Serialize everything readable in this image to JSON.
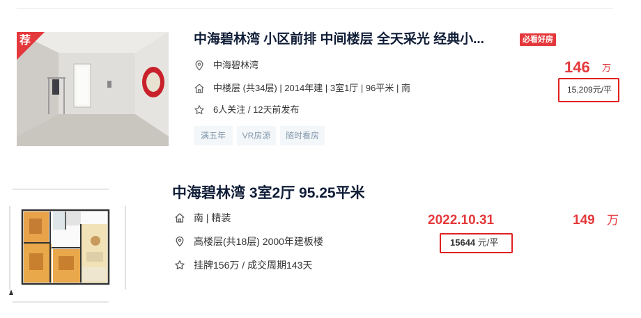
{
  "listing1": {
    "recommend_badge": "荐",
    "title": "中海碧林湾 小区前排 中间楼层 全天采光 经典小...",
    "must_see_badge": "必看好房",
    "community": "中海碧林湾",
    "house_info": "中楼层 (共34层) | 2014年建 | 3室1厅 | 96平米 | 南",
    "follow_info": "6人关注 / 12天前发布",
    "tags": [
      "满五年",
      "VR房源",
      "随时看房"
    ],
    "total_price": "146",
    "total_price_unit": "万",
    "unit_price": "15,209元/平",
    "icons": {
      "location": "location-pin-icon",
      "house": "house-icon",
      "follow": "star-icon"
    }
  },
  "listing2": {
    "title": "中海碧林湾 3室2厅 95.25平米",
    "orientation_decor": "南 | 精装",
    "floor_info": "高楼层(共18层) 2000年建板楼",
    "deal_info": "挂牌156万 / 成交周期143天",
    "deal_date": "2022.10.31",
    "total_price": "149",
    "total_price_unit": "万",
    "unit_price_value": "15644",
    "unit_price_suffix": " 元/平",
    "icons": {
      "house": "house-icon",
      "location": "location-pin-icon",
      "tag": "star-icon"
    }
  },
  "colors": {
    "accent": "#e4393c",
    "title": "#101d37",
    "tag_text": "#849aae",
    "tag_bg": "#f4f7f9",
    "box_border": "#e02020"
  }
}
